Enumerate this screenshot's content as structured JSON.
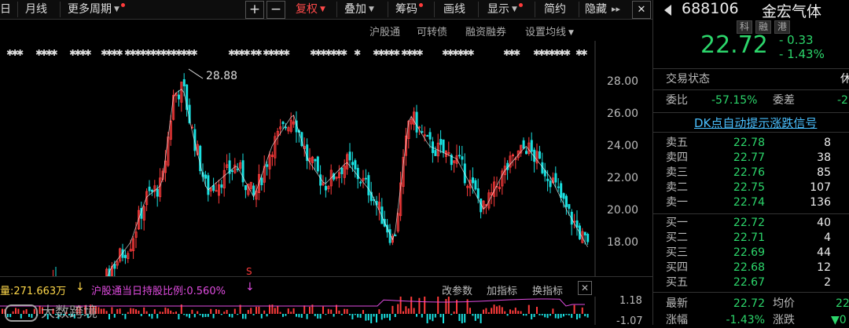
{
  "toolbar": {
    "items": [
      {
        "label": "日",
        "dot": false,
        "caret": false
      },
      {
        "label": "月线",
        "dot": false,
        "caret": false
      },
      {
        "label": "更多周期",
        "dot": true,
        "caret": true
      },
      {
        "label": "复权",
        "dot": false,
        "caret": true,
        "active": true
      },
      {
        "label": "叠加",
        "dot": false,
        "caret": true
      },
      {
        "label": "筹码",
        "dot": true,
        "caret": false
      },
      {
        "label": "画线",
        "dot": false,
        "caret": false
      },
      {
        "label": "显示",
        "dot": false,
        "caret": true
      },
      {
        "label": "简约",
        "dot": false,
        "caret": false
      },
      {
        "label": "隐藏",
        "dot": false,
        "caret": false
      }
    ],
    "plus": "+",
    "minus": "−",
    "expand": "▸▸",
    "close": "✕"
  },
  "subbar": {
    "hgt": "沪股通",
    "convertible": "可转债",
    "margin": "融资融券",
    "ma_settings": "设置均线"
  },
  "chart": {
    "peak_label": "28.88",
    "y_ticks": [
      "28.00",
      "26.00",
      "24.00",
      "22.00",
      "20.00",
      "18.00"
    ],
    "marker": "S",
    "up_color": "#ff3b3b",
    "down_color": "#19e0e0",
    "ma_color": "#ffffff"
  },
  "volume": {
    "title": "量:271.663万",
    "title_arrow": "↓",
    "ratio": "沪股通当日持股比例:0.560%",
    "ratio_arrow": "↓",
    "change_params": "改参数",
    "add_indicator": "加指标",
    "switch_indicator": "换指标",
    "close": "✕",
    "axis_top": "1.18",
    "axis_bottom": "-1.07"
  },
  "watermark": "大数跨境",
  "panel": {
    "code": "688106",
    "name": "金宏气体",
    "tags": [
      "科",
      "融",
      "港"
    ],
    "price": "22.72",
    "change": "- 0.33",
    "change_pct": "- 1.43%",
    "status_label": "交易状态",
    "status_value": "休",
    "weibi_label": "委比",
    "weibi_value": "-57.15%",
    "weicha_label": "委差",
    "weicha_value": "-2",
    "dk_title": "DK点自动提示涨跌信号",
    "asks": [
      {
        "label": "卖五",
        "price": "22.78",
        "vol": "8"
      },
      {
        "label": "卖四",
        "price": "22.77",
        "vol": "38"
      },
      {
        "label": "卖三",
        "price": "22.76",
        "vol": "85"
      },
      {
        "label": "卖二",
        "price": "22.75",
        "vol": "107"
      },
      {
        "label": "卖一",
        "price": "22.74",
        "vol": "136"
      }
    ],
    "bids": [
      {
        "label": "买一",
        "price": "22.72",
        "vol": "40"
      },
      {
        "label": "买二",
        "price": "22.71",
        "vol": "4"
      },
      {
        "label": "买三",
        "price": "22.69",
        "vol": "44"
      },
      {
        "label": "买四",
        "price": "22.68",
        "vol": "12"
      },
      {
        "label": "买五",
        "price": "22.67",
        "vol": "2"
      }
    ],
    "latest_label": "最新",
    "latest_value": "22.72",
    "avg_label": "均价",
    "avg_value": "22",
    "chg_label": "涨幅",
    "chg_value": "-1.43%",
    "chg2_label": "涨跌",
    "chg2_value": "▼0"
  }
}
